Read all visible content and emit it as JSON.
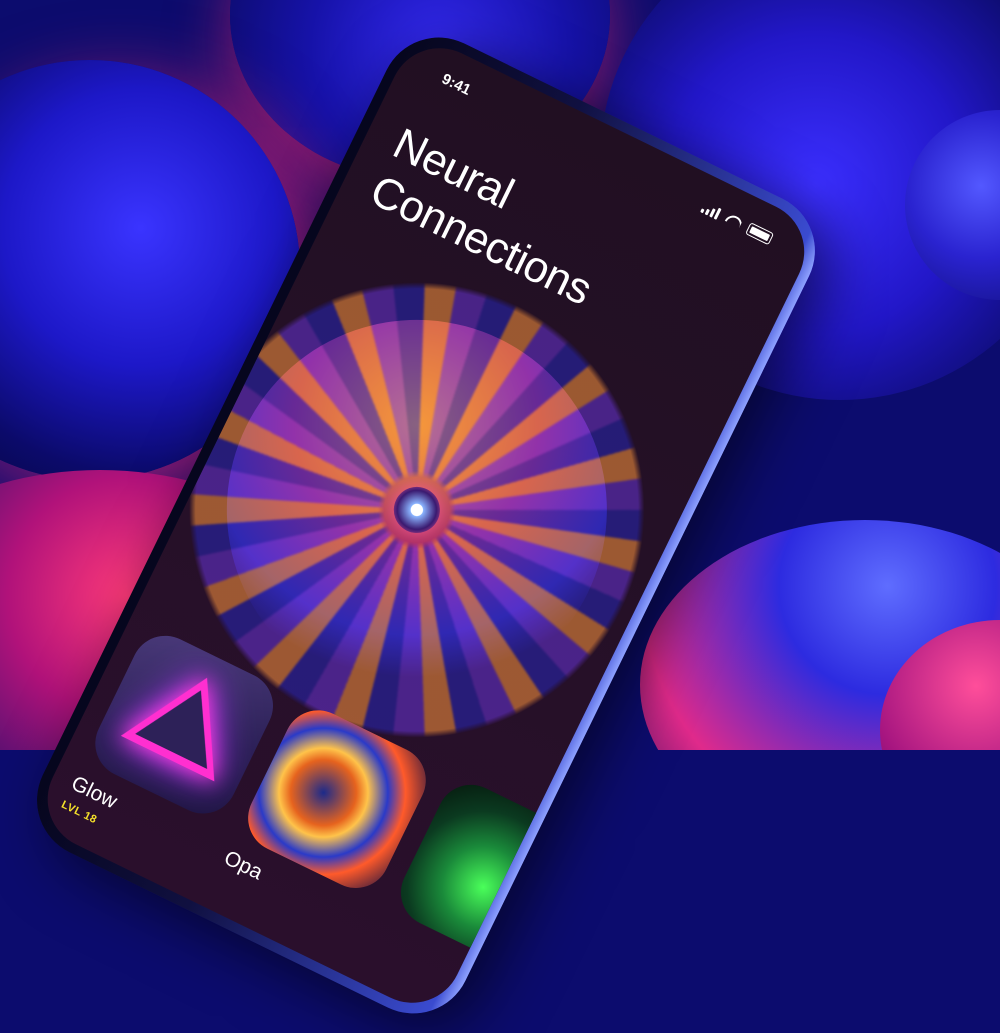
{
  "status_bar": {
    "time": "9:41"
  },
  "header": {
    "title_line1": "Neural",
    "title_line2": "Connections"
  },
  "hero": {
    "subject": "glass-flower"
  },
  "cards": [
    {
      "name": "Glow",
      "level": "LVL 18",
      "icon": "neon-triangle"
    },
    {
      "name": "Opa",
      "level": "",
      "icon": "opal-swirl"
    },
    {
      "name": "",
      "level": "",
      "icon": "green-mesh"
    }
  ],
  "colors": {
    "accent_level": "#f5e12a",
    "screen_bg": "#220f24",
    "title": "#ffffff"
  }
}
